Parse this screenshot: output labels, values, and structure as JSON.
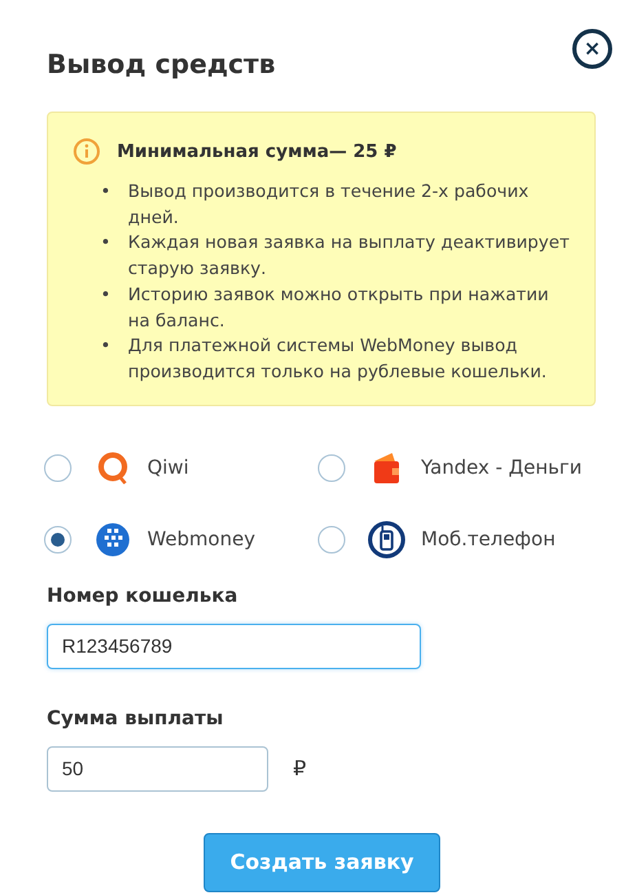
{
  "dialog": {
    "title": "Вывод средств",
    "close": "×"
  },
  "notice": {
    "heading": "Минимальная сумма— 25 ₽",
    "items": [
      {
        "bullet": "•",
        "text": "Вывод производится в течение 2-х рабочих дней."
      },
      {
        "bullet": "•",
        "text": "Каждая новая заявка на выплату деактивирует старую заявку."
      },
      {
        "bullet": "•",
        "text": "Историю заявок можно открыть при нажатии на баланс."
      },
      {
        "bullet": "•",
        "text": "Для платежной системы WebMoney вывод производится только на рублевые кошельки."
      }
    ]
  },
  "methods": [
    {
      "kind": "qiwi",
      "label": "Qiwi",
      "selected": false
    },
    {
      "kind": "yandex",
      "label": "Yandex - Деньги",
      "selected": false
    },
    {
      "kind": "webmoney",
      "label": "Webmoney",
      "selected": true
    },
    {
      "kind": "phone",
      "label": "Моб.телефон",
      "selected": false
    }
  ],
  "fields": [
    {
      "label": "Номер кошелька",
      "value": "R123456789",
      "focused": true
    },
    {
      "label": "Сумма выплаты",
      "value": "50",
      "focused": false,
      "unit": "₽"
    }
  ],
  "submit": "Создать заявку"
}
